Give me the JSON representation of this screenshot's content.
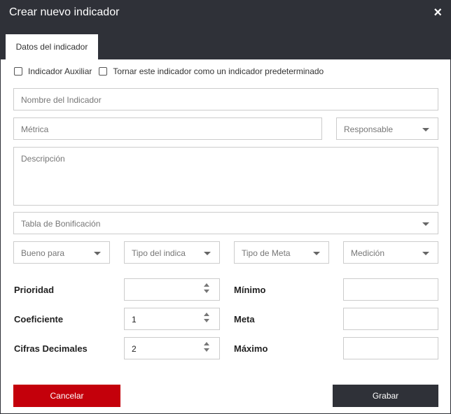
{
  "header": {
    "title": "Crear nuevo indicador",
    "close_icon": "×"
  },
  "tabs": [
    {
      "label": "Datos del indicador"
    }
  ],
  "checkboxes": {
    "auxiliar": "Indicador Auxiliar",
    "predeterminado": "Tornar este indicador como un indicador predeterminado"
  },
  "fields": {
    "nombre": "Nombre del Indicador",
    "metrica": "Métrica",
    "responsable": "Responsable",
    "descripcion": "Descripción",
    "tabla": "Tabla de Bonificación",
    "bueno": "Bueno para",
    "tipo_indica": "Tipo del indica",
    "tipo_meta": "Tipo de Meta",
    "medicion": "Medición"
  },
  "numeric": {
    "prioridad": {
      "label": "Prioridad",
      "value": ""
    },
    "coeficiente": {
      "label": "Coeficiente",
      "value": "1"
    },
    "cifras": {
      "label": "Cifras Decimales",
      "value": "2"
    },
    "minimo": {
      "label": "Mínimo",
      "value": ""
    },
    "meta": {
      "label": "Meta",
      "value": ""
    },
    "maximo": {
      "label": "Máximo",
      "value": ""
    }
  },
  "buttons": {
    "cancel": "Cancelar",
    "save": "Grabar"
  },
  "colors": {
    "header_bg": "#2f3138",
    "cancel_bg": "#c4000b",
    "save_bg": "#2f3138"
  }
}
